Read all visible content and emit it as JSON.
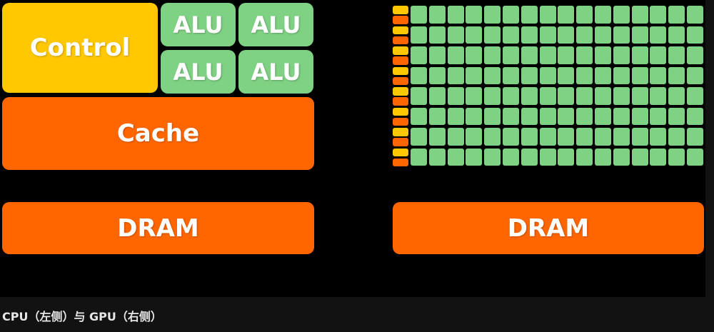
{
  "cpu": {
    "control_label": "Control",
    "alu_labels": [
      "ALU",
      "ALU",
      "ALU",
      "ALU"
    ],
    "cache_label": "Cache",
    "dram_label": "DRAM"
  },
  "gpu": {
    "rows": 8,
    "alus_per_row": 16,
    "dram_label": "DRAM"
  },
  "colors": {
    "control": "#ffc800",
    "alu": "#7fd184",
    "cache_dram": "#ff6600",
    "background": "#000000"
  },
  "caption": "CPU（左侧）与 GPU（右侧）"
}
